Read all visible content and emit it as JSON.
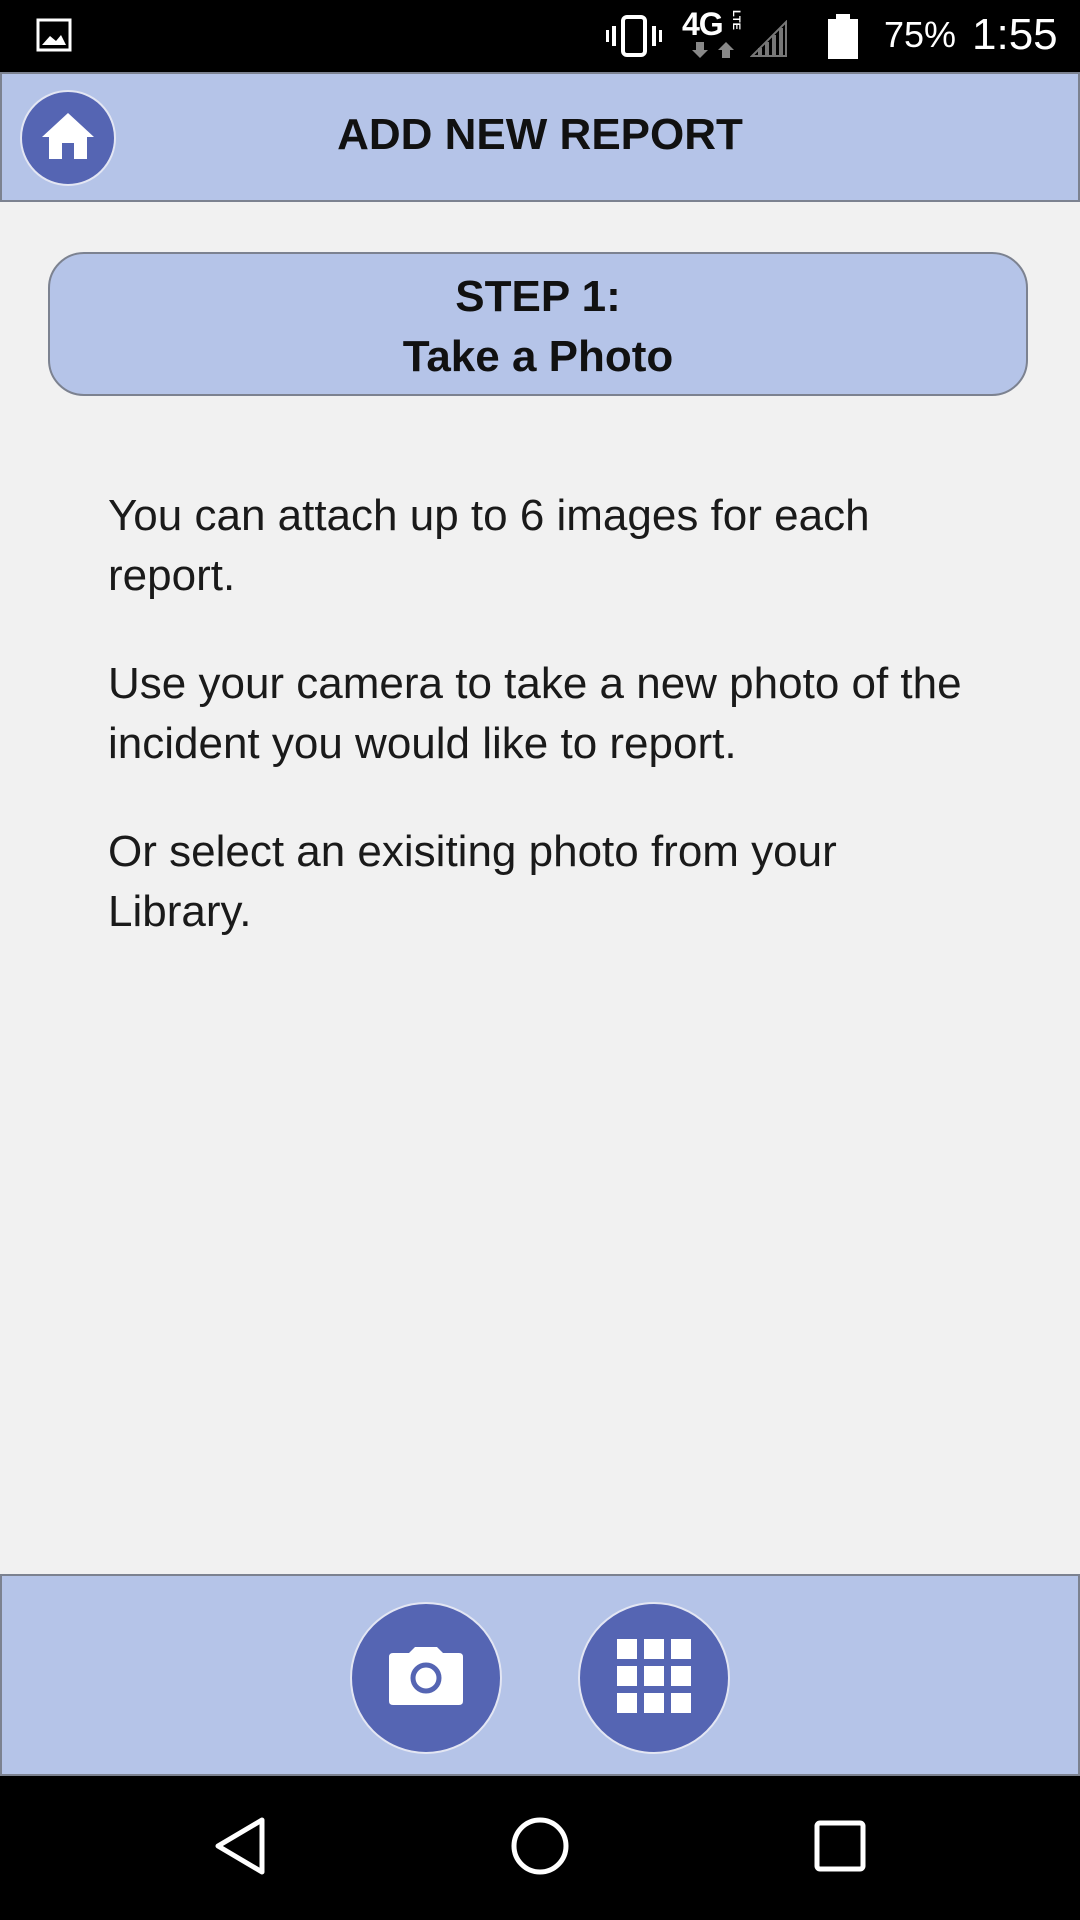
{
  "status_bar": {
    "network": "4G",
    "network_sub": "LTE",
    "battery_percent": "75%",
    "battery_level": 0.75,
    "time": "1:55",
    "icons": [
      "gallery-icon",
      "vibrate-icon",
      "data-arrows-icon",
      "signal-icon",
      "battery-icon"
    ]
  },
  "header": {
    "title": "ADD NEW REPORT",
    "home_icon": "home-icon"
  },
  "step": {
    "number": "STEP 1:",
    "title": "Take a Photo"
  },
  "instructions": [
    "You can attach up to 6 images for each report.",
    "Use your camera to take a new photo of the incident you would like to report.",
    "Or select an exisiting photo from your Library."
  ],
  "toolbar": {
    "camera_icon": "camera-icon",
    "library_icon": "grid-icon"
  },
  "nav_bar": {
    "icons": [
      "back-icon",
      "home-circle-icon",
      "recents-icon"
    ]
  },
  "colors": {
    "accent": "#5565b3",
    "panel": "#b5c4e8",
    "background": "#f1f1f1",
    "border": "#7c8290"
  }
}
